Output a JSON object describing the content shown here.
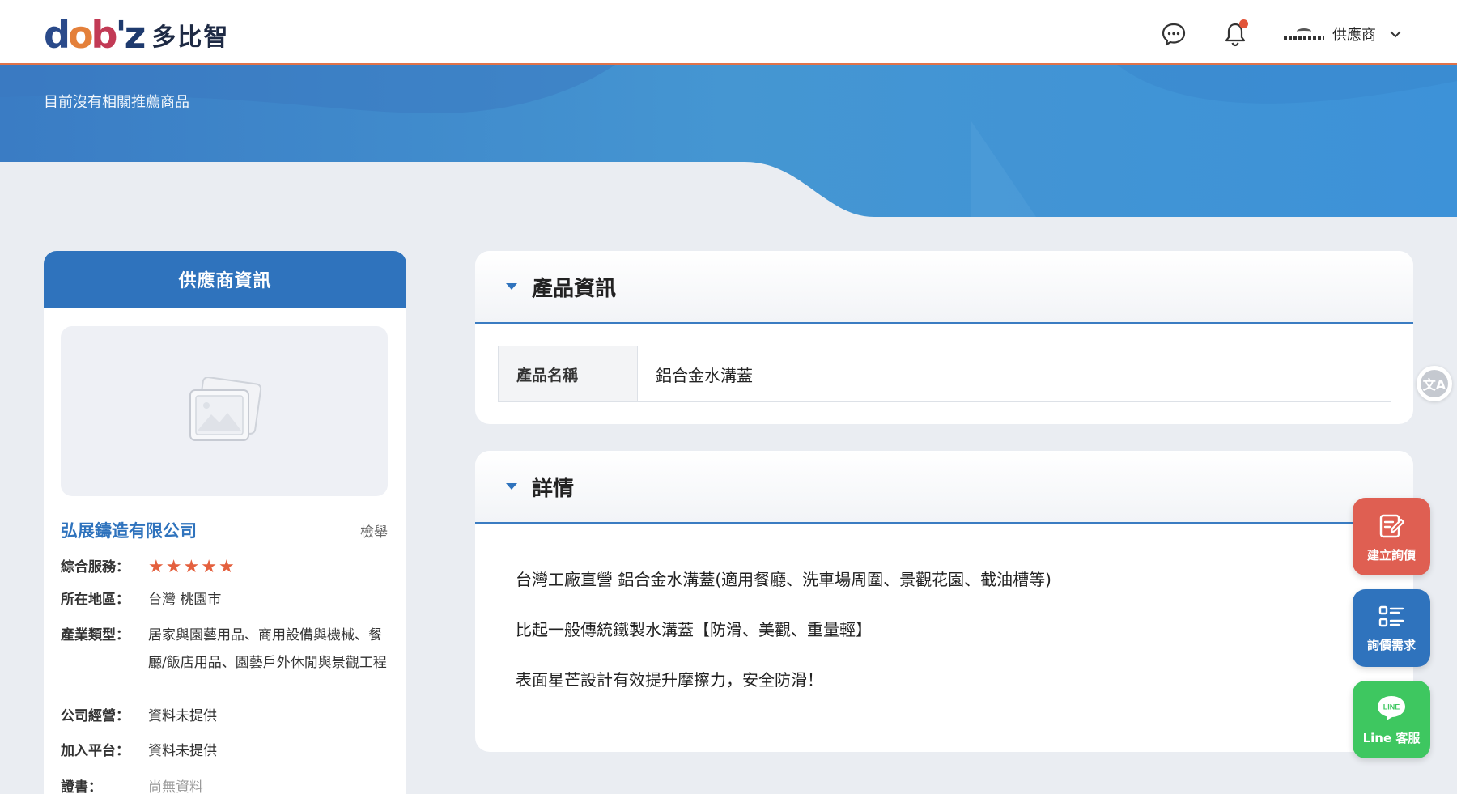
{
  "brand": {
    "mark": "dobiz",
    "name": "多比智"
  },
  "header": {
    "user_label": "供應商",
    "user_logo_text": "奇築營造行銷"
  },
  "banner": {
    "message": "目前沒有相關推薦商品"
  },
  "supplier": {
    "heading": "供應商資訊",
    "company_name": "弘展鑄造有限公司",
    "report_label": "檢舉",
    "rating": 5,
    "fields": [
      {
        "label": "綜合服務：",
        "value": ""
      },
      {
        "label": "所在地區：",
        "value": "台灣 桃園市"
      },
      {
        "label": "產業類型：",
        "value": "居家與園藝用品、商用設備與機械、餐廳/飯店用品、園藝戶外休閒與景觀工程"
      },
      {
        "label": "公司經營：",
        "value": "資料未提供"
      },
      {
        "label": "加入平台：",
        "value": "資料未提供"
      },
      {
        "label": "證書：",
        "value": "尚無資料"
      }
    ]
  },
  "product": {
    "section_title": "產品資訊",
    "name_label": "產品名稱",
    "name_value": "鋁合金水溝蓋"
  },
  "details": {
    "section_title": "詳情",
    "lines": [
      "台灣工廠直營 鋁合金水溝蓋(適用餐廳、洗車場周圍、景觀花園、截油槽等)",
      "比起一般傳統鐵製水溝蓋【防滑、美觀、重量輕】",
      "表面星芒設計有效提升摩擦力，安全防滑！"
    ]
  },
  "fabs": {
    "create_quote": "建立詢價",
    "quote_requests": "詢價需求",
    "line_service": "Line 客服",
    "line_badge": "LINE"
  },
  "colors": {
    "primary": "#2f73bd",
    "accent_red": "#df5f52",
    "line_green": "#3ec760",
    "star": "#e4603e"
  }
}
